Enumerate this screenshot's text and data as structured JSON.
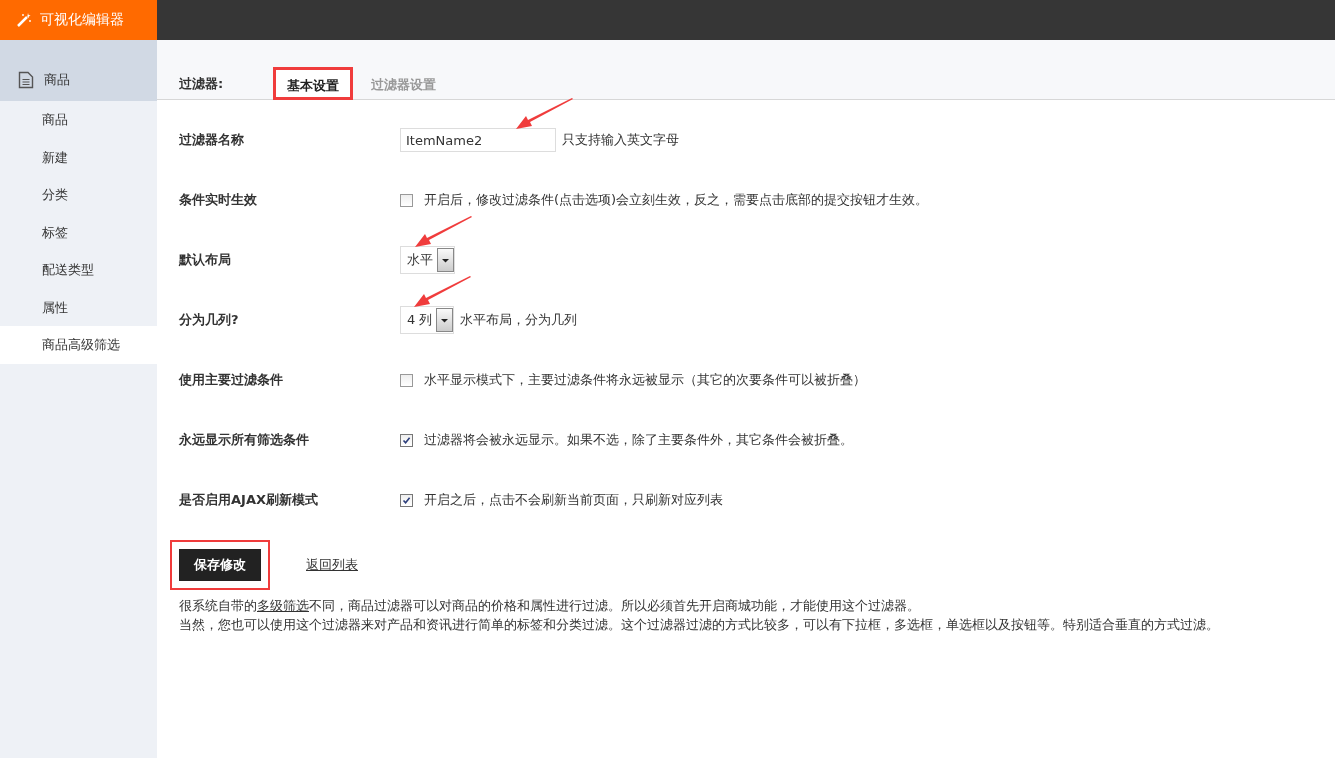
{
  "app_title": "可视化编辑器",
  "sidebar": {
    "group": "商品",
    "items": [
      {
        "label": "商品",
        "selected": false
      },
      {
        "label": "新建",
        "selected": false
      },
      {
        "label": "分类",
        "selected": false
      },
      {
        "label": "标签",
        "selected": false
      },
      {
        "label": "配送类型",
        "selected": false
      },
      {
        "label": "属性",
        "selected": false
      },
      {
        "label": "商品高级筛选",
        "selected": true
      }
    ]
  },
  "tabs_label": "过滤器:",
  "tabs": [
    {
      "label": "基本设置",
      "selected": true,
      "highlighted": true
    },
    {
      "label": "过滤器设置",
      "selected": false,
      "highlighted": false
    }
  ],
  "rows": [
    {
      "kind": "input",
      "label": "过滤器名称",
      "value": "ItemName2",
      "hint": "只支持输入英文字母",
      "arrow": true
    },
    {
      "kind": "checkbox",
      "label": "条件实时生效",
      "checked": false,
      "hint": "开启后，修改过滤条件(点击选项)会立刻生效，反之，需要点击底部的提交按钮才生效。",
      "arrow": false
    },
    {
      "kind": "select",
      "label": "默认布局",
      "value": "水平",
      "arrow": true
    },
    {
      "kind": "select",
      "label": "分为几列?",
      "value": "4 列",
      "hint": "水平布局，分为几列",
      "arrow": true
    },
    {
      "kind": "checkbox",
      "label": "使用主要过滤条件",
      "checked": false,
      "hint": "水平显示模式下，主要过滤条件将永远被显示（其它的次要条件可以被折叠）",
      "arrow": false
    },
    {
      "kind": "checkbox",
      "label": "永远显示所有筛选条件",
      "checked": true,
      "hint": "过滤器将会被永远显示。如果不选，除了主要条件外，其它条件会被折叠。",
      "arrow": false
    },
    {
      "kind": "checkbox",
      "label": "是否启用AJAX刷新模式",
      "checked": true,
      "hint": "开启之后，点击不会刷新当前页面，只刷新对应列表",
      "arrow": false
    }
  ],
  "save_button": {
    "label": "保存修改",
    "highlighted": true
  },
  "back_link": "返回列表",
  "description": [
    {
      "parts": [
        {
          "text": "很系统自带的",
          "link": false
        },
        {
          "text": "多级筛选",
          "link": true
        },
        {
          "text": "不同，商品过滤器可以对商品的价格和属性进行过滤。所以必须首先开启商城功能，才能使用这个过滤器。",
          "link": false
        }
      ]
    },
    {
      "parts": [
        {
          "text": "当然，您也可以使用这个过滤器来对产品和资讯进行简单的标签和分类过滤。这个过滤器过滤的方式比较多，可以有下拉框，多选框，单选框以及按钮等。特别适合垂直的方式过滤。",
          "link": false
        }
      ]
    }
  ]
}
